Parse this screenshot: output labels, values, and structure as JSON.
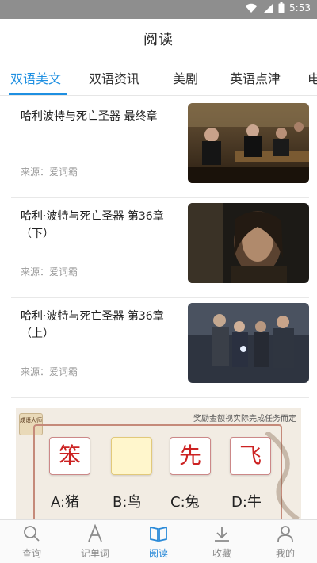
{
  "status_bar": {
    "time": "5:53",
    "icons": [
      "wifi-icon",
      "signal-icon",
      "battery-icon"
    ]
  },
  "header": {
    "title": "阅读"
  },
  "tabs": [
    {
      "label": "双语美文",
      "active": true
    },
    {
      "label": "双语资讯",
      "active": false
    },
    {
      "label": "美剧",
      "active": false
    },
    {
      "label": "英语点津",
      "active": false
    },
    {
      "label": "电",
      "active": false
    }
  ],
  "articles": [
    {
      "title": "哈利波特与死亡圣器 最终章",
      "source": "来源：爱词霸"
    },
    {
      "title": "哈利·波特与死亡圣器 第36章（下）",
      "source": "来源：爱词霸"
    },
    {
      "title": "哈利·波特与死亡圣器 第36章（上）",
      "source": "来源：爱词霸"
    }
  ],
  "ad": {
    "note": "奖励金额视实际完成任务而定",
    "logo_text": "成语大师",
    "chars": [
      "笨",
      "",
      "先",
      "飞"
    ],
    "options": [
      "A:猪",
      "B:鸟",
      "C:兔",
      "D:牛"
    ]
  },
  "bottom_nav": [
    {
      "label": "查询",
      "icon": "search-icon",
      "active": false
    },
    {
      "label": "记单词",
      "icon": "letter-a-icon",
      "active": false
    },
    {
      "label": "阅读",
      "icon": "book-icon",
      "active": true
    },
    {
      "label": "收藏",
      "icon": "download-icon",
      "active": false
    },
    {
      "label": "我的",
      "icon": "person-icon",
      "active": false
    }
  ],
  "colors": {
    "accent": "#1e8fe1",
    "status_bar": "#8e8e8e",
    "source_text": "#9a9a9a"
  }
}
